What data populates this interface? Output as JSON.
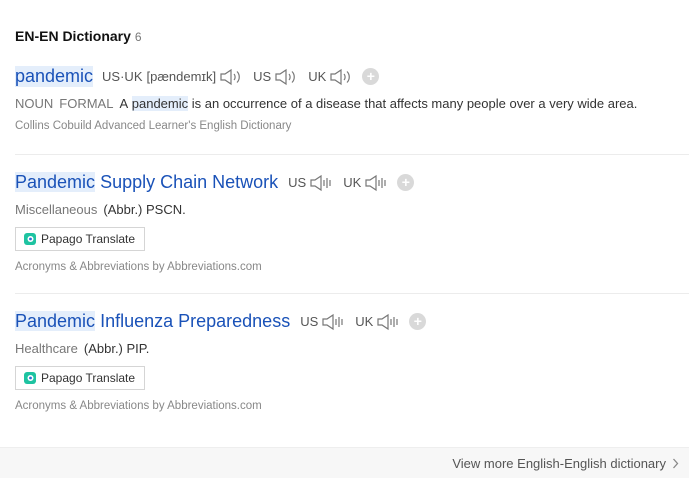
{
  "section": {
    "title": "EN-EN Dictionary",
    "count": "6"
  },
  "entry1": {
    "headword": "pandemic",
    "pron_regions": "US·UK",
    "ipa": "[pændemɪk]",
    "us_label": "US",
    "uk_label": "UK",
    "pos1": "NOUN",
    "pos2": "FORMAL",
    "def_prefix": "A",
    "def_highlight": "pandemic",
    "def_suffix": "is an occurrence of a disease that affects many people over a very wide area.",
    "source": "Collins Cobuild Advanced Learner's English Dictionary"
  },
  "entry2": {
    "headword_hl": "Pandemic",
    "headword_rest": "Supply Chain Network",
    "us_label": "US",
    "uk_label": "UK",
    "category": "Miscellaneous",
    "def": "(Abbr.) PSCN.",
    "translate_label": "Papago Translate",
    "source": "Acronyms & Abbreviations by Abbreviations.com"
  },
  "entry3": {
    "headword_hl": "Pandemic",
    "headword_rest": "Influenza Preparedness",
    "us_label": "US",
    "uk_label": "UK",
    "category": "Healthcare",
    "def": "(Abbr.) PIP.",
    "translate_label": "Papago Translate",
    "source": "Acronyms & Abbreviations by Abbreviations.com"
  },
  "footer": {
    "more_label": "View more English-English dictionary"
  },
  "colors": {
    "headword": "#1a52b8",
    "highlight": "#e4eefb"
  }
}
